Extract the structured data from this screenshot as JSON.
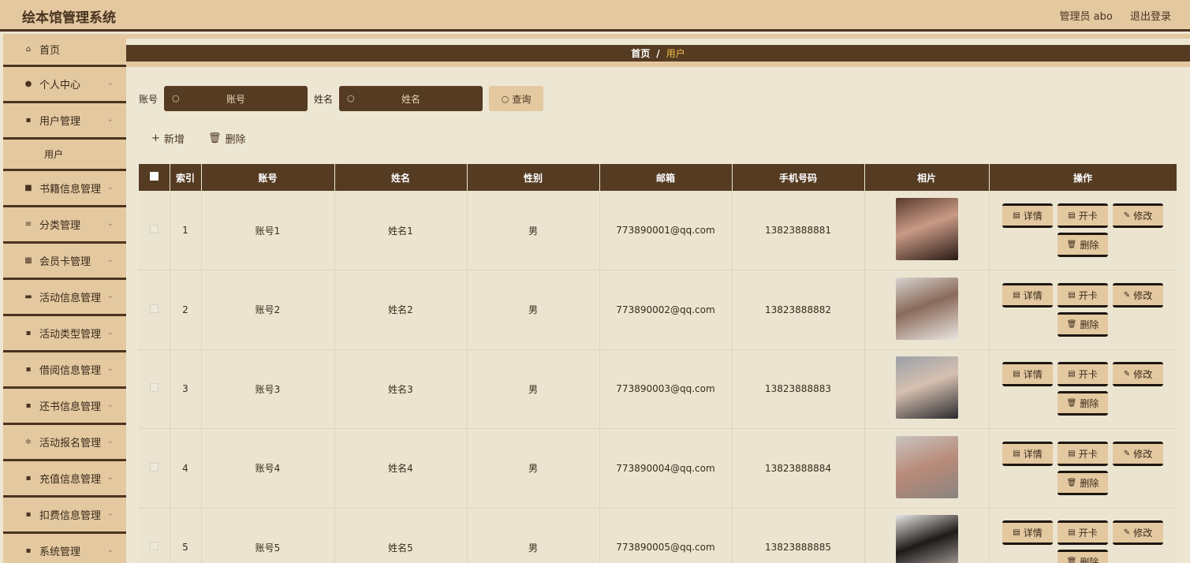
{
  "app": {
    "title": "绘本馆管理系统",
    "user": "管理员 abo",
    "logout": "退出登录"
  },
  "sidebar": {
    "items": [
      {
        "label": "首页",
        "icon": "home-icon",
        "glyph": "⌂"
      },
      {
        "label": "个人中心",
        "icon": "person-icon",
        "glyph": "●"
      },
      {
        "label": "用户管理",
        "icon": "grid-icon",
        "glyph": "▪"
      },
      {
        "label": "书籍信息管理",
        "icon": "book-icon",
        "glyph": "■"
      },
      {
        "label": "分类管理",
        "icon": "list-icon",
        "glyph": "≡"
      },
      {
        "label": "会员卡管理",
        "icon": "grid-icon",
        "glyph": "▦"
      },
      {
        "label": "活动信息管理",
        "icon": "monitor-icon",
        "glyph": "▬"
      },
      {
        "label": "活动类型管理",
        "icon": "grid-icon",
        "glyph": "▪"
      },
      {
        "label": "借阅信息管理",
        "icon": "grid-icon",
        "glyph": "▪"
      },
      {
        "label": "还书信息管理",
        "icon": "grid-icon",
        "glyph": "▪"
      },
      {
        "label": "活动报名管理",
        "icon": "sliders-icon",
        "glyph": "≑"
      },
      {
        "label": "充值信息管理",
        "icon": "grid-icon",
        "glyph": "▪"
      },
      {
        "label": "扣费信息管理",
        "icon": "grid-icon",
        "glyph": "▪"
      },
      {
        "label": "系统管理",
        "icon": "grid-icon",
        "glyph": "▪"
      }
    ],
    "sub_item": "用户",
    "chevron": "⌄"
  },
  "breadcrumb": {
    "home": "首页",
    "sep": "/",
    "current": "用户"
  },
  "search": {
    "account_label": "账号",
    "account_placeholder": "账号",
    "name_label": "姓名",
    "name_placeholder": "姓名",
    "button": "查询"
  },
  "actions": {
    "add": "新增",
    "delete": "删除"
  },
  "table": {
    "headers": [
      "索引",
      "账号",
      "姓名",
      "性别",
      "邮箱",
      "手机号码",
      "相片",
      "操作"
    ],
    "rows": [
      {
        "index": "1",
        "account": "账号1",
        "name": "姓名1",
        "gender": "男",
        "email": "773890001@qq.com",
        "phone": "13823888881"
      },
      {
        "index": "2",
        "account": "账号2",
        "name": "姓名2",
        "gender": "男",
        "email": "773890002@qq.com",
        "phone": "13823888882"
      },
      {
        "index": "3",
        "account": "账号3",
        "name": "姓名3",
        "gender": "男",
        "email": "773890003@qq.com",
        "phone": "13823888883"
      },
      {
        "index": "4",
        "account": "账号4",
        "name": "姓名4",
        "gender": "男",
        "email": "773890004@qq.com",
        "phone": "13823888884"
      },
      {
        "index": "5",
        "account": "账号5",
        "name": "姓名5",
        "gender": "男",
        "email": "773890005@qq.com",
        "phone": "13823888885"
      }
    ],
    "ops": {
      "detail": "详情",
      "card": "开卡",
      "edit": "修改",
      "delete": "删除"
    }
  },
  "colors": {
    "header_bg": "#e3c8a0",
    "dark": "#543b22",
    "page_bg": "#ece6d3",
    "crumb_current": "#f2c24f"
  }
}
